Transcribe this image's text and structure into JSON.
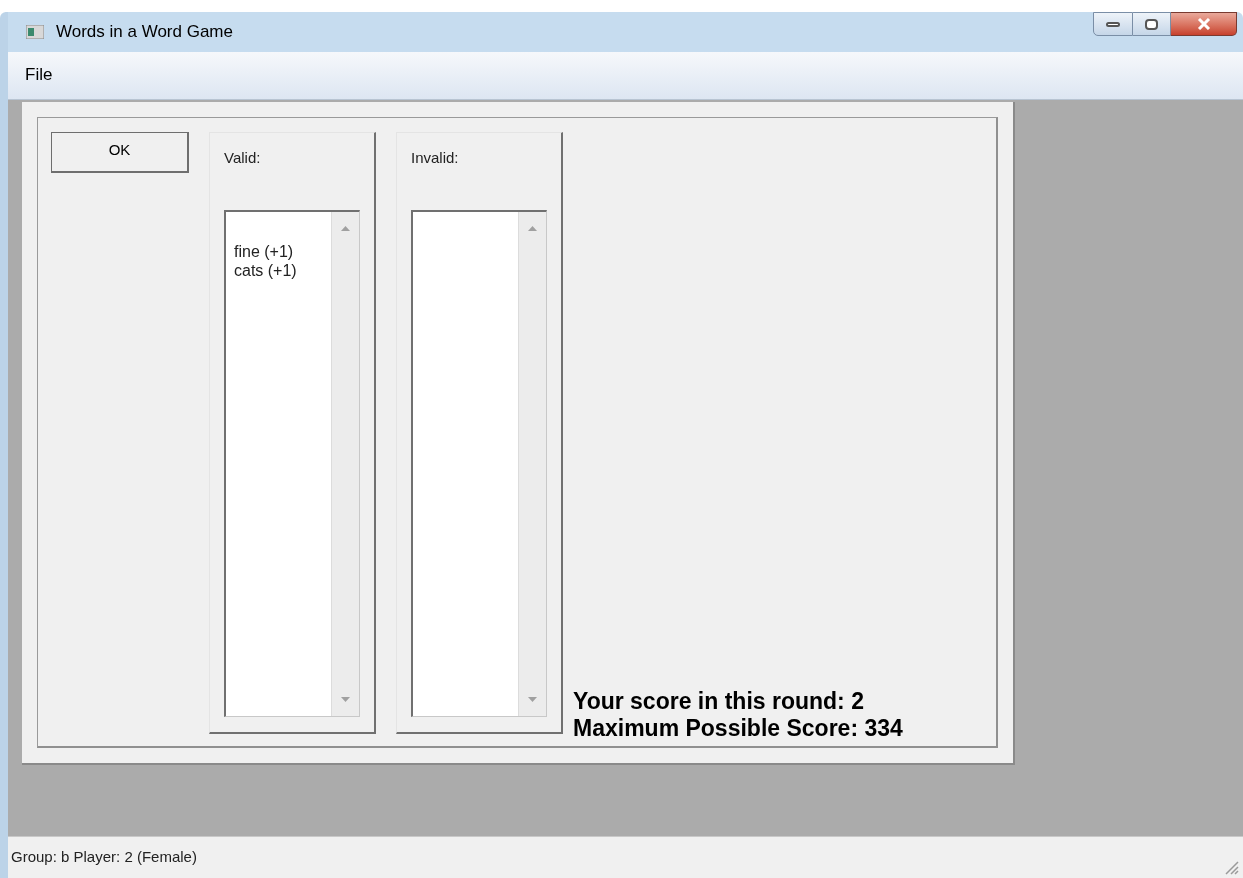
{
  "window": {
    "title": "Words in a Word Game"
  },
  "menu": [
    "File"
  ],
  "ok_button": "OK",
  "lists": [
    {
      "label": "Valid:",
      "items": [
        "fine (+1)",
        "cats (+1)"
      ]
    },
    {
      "label": "Invalid:"
    }
  ],
  "score_lines": [
    "Your score in this round: 2",
    "Maximum Possible Score: 334"
  ],
  "status_bar": "Group: b Player: 2 (Female)"
}
